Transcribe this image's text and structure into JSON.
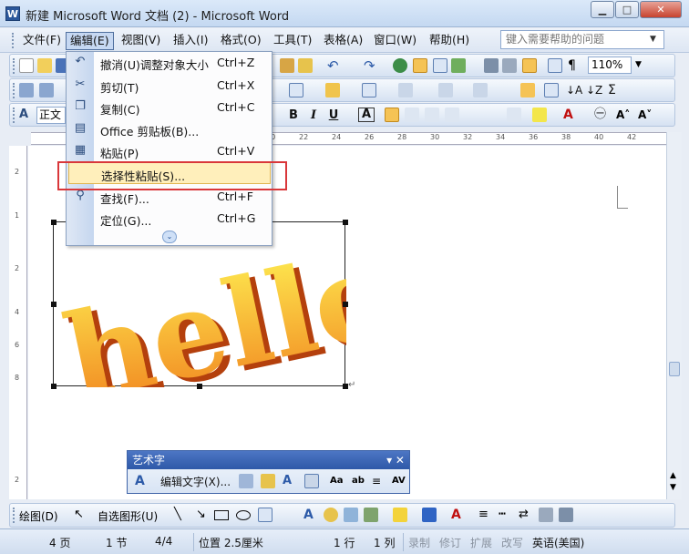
{
  "window": {
    "title": "新建 Microsoft Word 文档 (2) - Microsoft Word",
    "app_icon_glyph": "W",
    "minimize_glyph": "▁",
    "maximize_glyph": "□",
    "close_glyph": "✕"
  },
  "menubar": {
    "items": [
      "文件(F)",
      "编辑(E)",
      "视图(V)",
      "插入(I)",
      "格式(O)",
      "工具(T)",
      "表格(A)",
      "窗口(W)",
      "帮助(H)"
    ],
    "help_placeholder": "键入需要帮助的问题"
  },
  "toolbar": {
    "zoom": "110%",
    "style": "正文",
    "bold": "B",
    "italic": "I",
    "underline": "U",
    "char_border": "A"
  },
  "ruler": {
    "h_ticks": [
      "20",
      "22",
      "24",
      "26",
      "28",
      "30",
      "32",
      "34",
      "36",
      "38",
      "40",
      "42"
    ],
    "v_ticks": [
      "2",
      "1",
      "2",
      "4",
      "6",
      "8",
      "2"
    ]
  },
  "edit_menu": {
    "items": [
      {
        "label": "撤消(U)调整对象大小",
        "shortcut": "Ctrl+Z",
        "icon": "undo-icon",
        "glyph": "↶"
      },
      {
        "label": "剪切(T)",
        "shortcut": "Ctrl+X",
        "icon": "scissors-icon",
        "glyph": "✂"
      },
      {
        "label": "复制(C)",
        "shortcut": "Ctrl+C",
        "icon": "copy-icon",
        "glyph": "❐"
      },
      {
        "label": "Office 剪贴板(B)...",
        "shortcut": "",
        "icon": "clipboard-icon",
        "glyph": "▤"
      },
      {
        "label": "粘贴(P)",
        "shortcut": "Ctrl+V",
        "icon": "paste-icon",
        "glyph": "▦"
      },
      {
        "label": "选择性粘贴(S)...",
        "shortcut": "",
        "icon": "",
        "glyph": ""
      },
      {
        "label": "查找(F)...",
        "shortcut": "Ctrl+F",
        "icon": "binoculars-icon",
        "glyph": "⚲"
      },
      {
        "label": "定位(G)...",
        "shortcut": "Ctrl+G",
        "icon": "",
        "glyph": ""
      }
    ],
    "more_glyph": "⌄"
  },
  "wordart_text": "hello",
  "wordart_toolbar": {
    "title": "艺术字",
    "edit_text": "编辑文字(X)...",
    "title_controls": "▾ ✕"
  },
  "drawing_toolbar": {
    "draw": "绘图(D)",
    "autoshapes": "自选图形(U)"
  },
  "statusbar": {
    "page": "4 页",
    "section": "1 节",
    "page_of": "4/4",
    "position": "位置 2.5厘米",
    "line": "1 行",
    "column": "1 列",
    "rec": "录制",
    "trk": "修订",
    "ext": "扩展",
    "ovr": "改写",
    "language": "英语(美国)"
  },
  "colors": {
    "menu_highlight": "#ffefbb",
    "annotation_box": "#d9373a",
    "wordart_orange": "#f39a1a"
  }
}
